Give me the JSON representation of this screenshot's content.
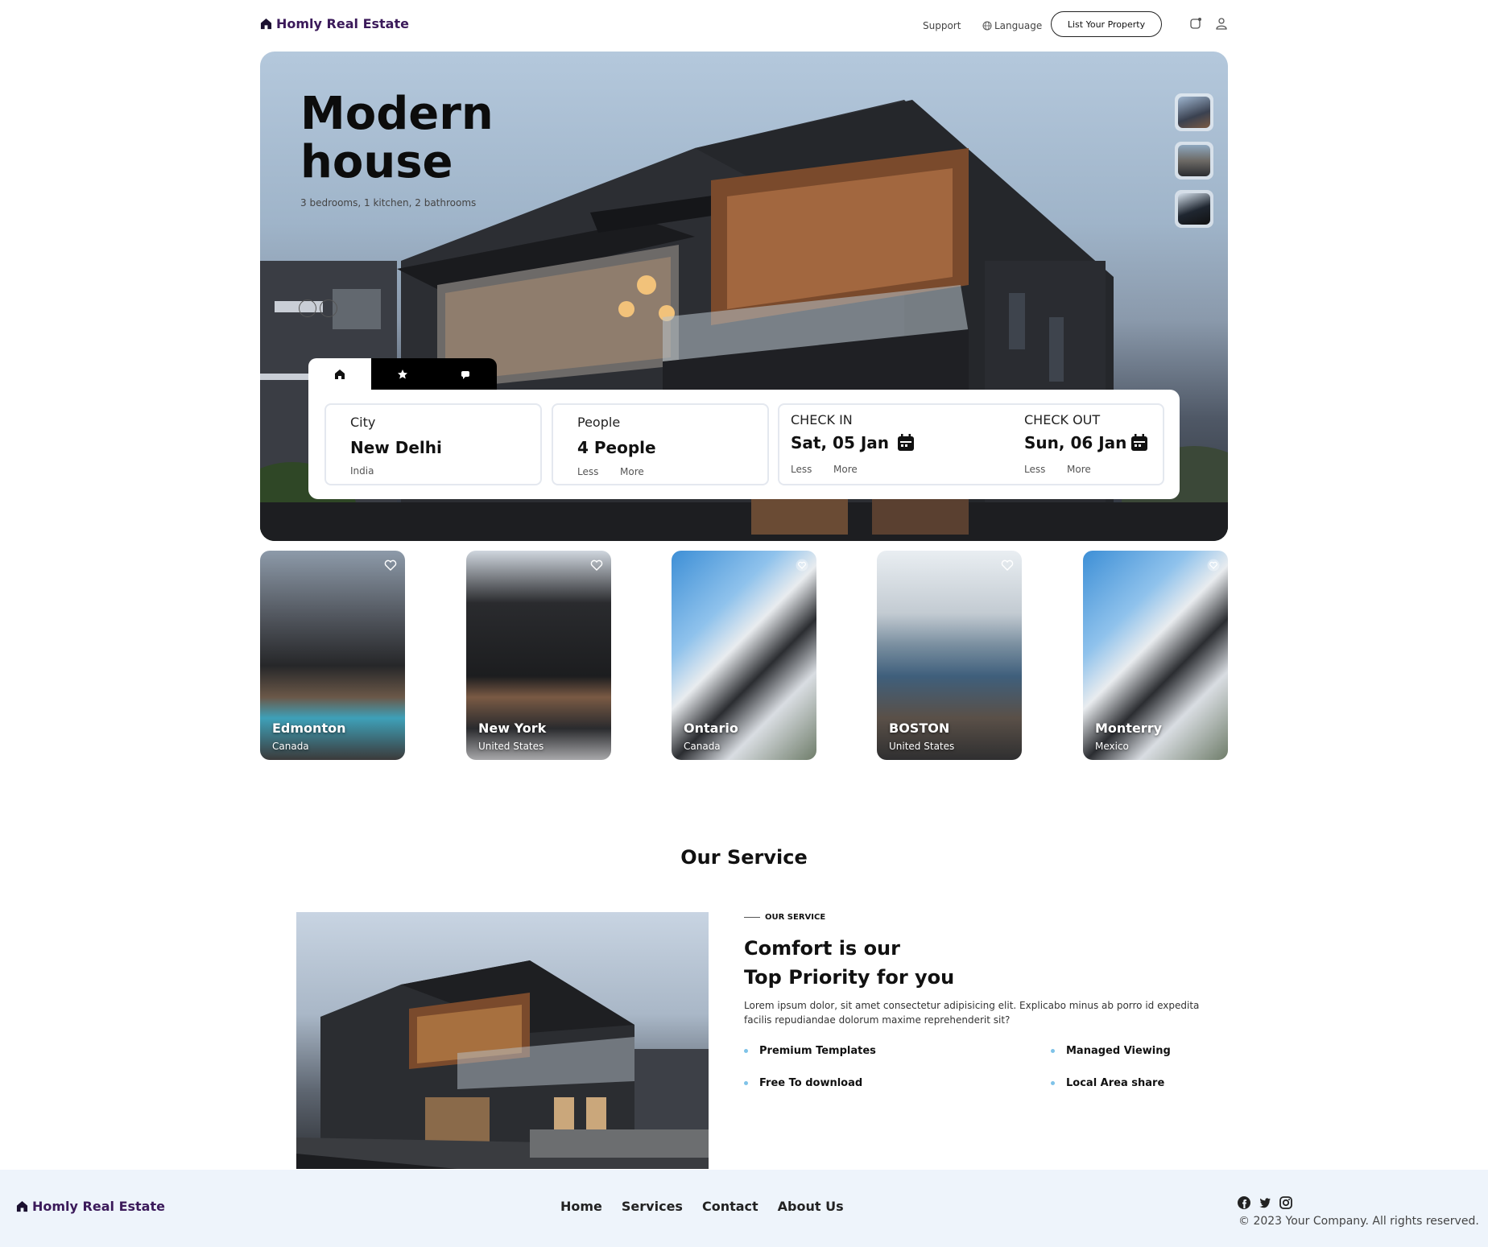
{
  "nav": {
    "brand": "Homly Real Estate",
    "support": "Support",
    "language": "Language",
    "list_property": "List Your Property"
  },
  "hero": {
    "title": "Modern house",
    "subtitle": "3 bedrooms, 1 kitchen, 2 bathrooms"
  },
  "booking": {
    "city": {
      "label": "City",
      "value": "New Delhi",
      "sub": "India"
    },
    "people": {
      "label": "People",
      "value": "4 People",
      "less": "Less",
      "more": "More"
    },
    "check_in": {
      "label": "CHECK IN",
      "value": "Sat, 05 Jan",
      "less": "Less",
      "more": "More"
    },
    "check_out": {
      "label": "CHECK OUT",
      "value": "Sun, 06 Jan",
      "less": "Less",
      "more": "More"
    }
  },
  "cities": [
    {
      "name": "Edmonton",
      "country": "Canada"
    },
    {
      "name": "New York",
      "country": "United States"
    },
    {
      "name": "Ontario",
      "country": "Canada"
    },
    {
      "name": "BOSTON",
      "country": "United States"
    },
    {
      "name": "Monterry",
      "country": "Mexico"
    }
  ],
  "service": {
    "section_title": "Our Service",
    "kicker": "OUR SERVICE",
    "heading_line1": "Comfort is our",
    "heading_line2": "Top Priority for you",
    "text": "Lorem ipsum dolor, sit amet consectetur adipisicing elit. Explicabo minus ab porro id expedita facilis repudiandae dolorum maxime reprehenderit sit?",
    "features": [
      "Premium Templates",
      "Managed Viewing",
      "Free To download",
      "Local Area share"
    ]
  },
  "footer": {
    "brand": "Homly Real Estate",
    "links": [
      "Home",
      "Services",
      "Contact",
      "About Us"
    ],
    "copyright": "© 2023 Your Company. All rights reserved."
  },
  "colors": {
    "brand": "#3b1a5a",
    "bullet": "#7fc3e8",
    "footer_bg": "#eef4fb"
  }
}
